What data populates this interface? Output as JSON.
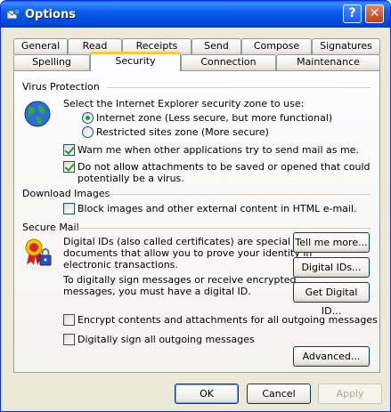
{
  "window": {
    "title": "Options"
  },
  "title_buttons": {
    "help": "?",
    "close": "✕"
  },
  "tabs_row1": [
    "General",
    "Read",
    "Receipts",
    "Send",
    "Compose",
    "Signatures"
  ],
  "tabs_row2": [
    "Spelling",
    "Security",
    "Connection",
    "Maintenance"
  ],
  "active_tab": "Security",
  "virus_protection": {
    "heading": "Virus Protection",
    "zone_prompt": "Select the Internet Explorer security zone to use:",
    "zone_options": [
      "Internet zone (Less secure, but more functional)",
      "Restricted sites zone (More secure)"
    ],
    "zone_selected": "Internet zone (Less secure, but more functional)",
    "warn_label": "Warn me when other applications try to send mail as me.",
    "warn_checked": true,
    "attach_label_line1": "Do not allow attachments to be saved or opened that could",
    "attach_label_line2": "potentially be a virus.",
    "attach_checked": true
  },
  "download_images": {
    "heading": "Download Images",
    "block_label": "Block images and other external content in HTML e-mail.",
    "block_checked": false
  },
  "secure_mail": {
    "heading": "Secure Mail",
    "desc1_line1": "Digital IDs (also called certificates) are special",
    "desc1_line2": "documents that allow you to prove your identity in",
    "desc1_line3": "electronic transactions.",
    "desc2_line1": "To digitally sign messages or receive encrypted",
    "desc2_line2": "messages, you must have a digital ID.",
    "tell_me_more": "Tell me more...",
    "digital_ids": "Digital IDs...",
    "get_digital_id": "Get Digital ID...",
    "encrypt_label": "Encrypt contents and attachments for all outgoing messages",
    "encrypt_checked": false,
    "sign_label": "Digitally sign all outgoing messages",
    "sign_checked": false,
    "advanced": "Advanced..."
  },
  "footer": {
    "ok": "OK",
    "cancel": "Cancel",
    "apply": "Apply"
  }
}
